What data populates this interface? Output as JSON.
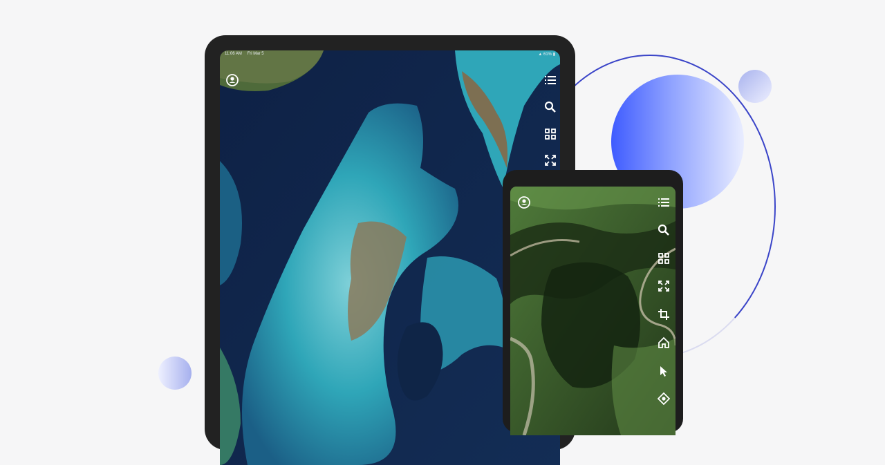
{
  "tablet": {
    "status_time": "11:06 AM",
    "status_date": "Fri Mar 5",
    "status_battery": "61%",
    "toolbar": [
      {
        "icon": "layer-list-icon"
      },
      {
        "icon": "search-icon"
      },
      {
        "icon": "grid-icon"
      },
      {
        "icon": "fullscreen-icon"
      }
    ]
  },
  "phone": {
    "toolbar": [
      {
        "icon": "layer-list-icon"
      },
      {
        "icon": "search-icon"
      },
      {
        "icon": "grid-icon"
      },
      {
        "icon": "fullscreen-icon"
      },
      {
        "icon": "crop-icon"
      },
      {
        "icon": "home-icon"
      },
      {
        "icon": "pointer-icon"
      },
      {
        "icon": "locate-icon"
      }
    ]
  },
  "colors": {
    "accent": "#3a44c8",
    "blob_gradient_start": "#3f5cff",
    "device_frame": "#222222",
    "ocean": "#0f2547",
    "shallow_water": "#2fa6b8",
    "terrain": "#2f4a26"
  }
}
